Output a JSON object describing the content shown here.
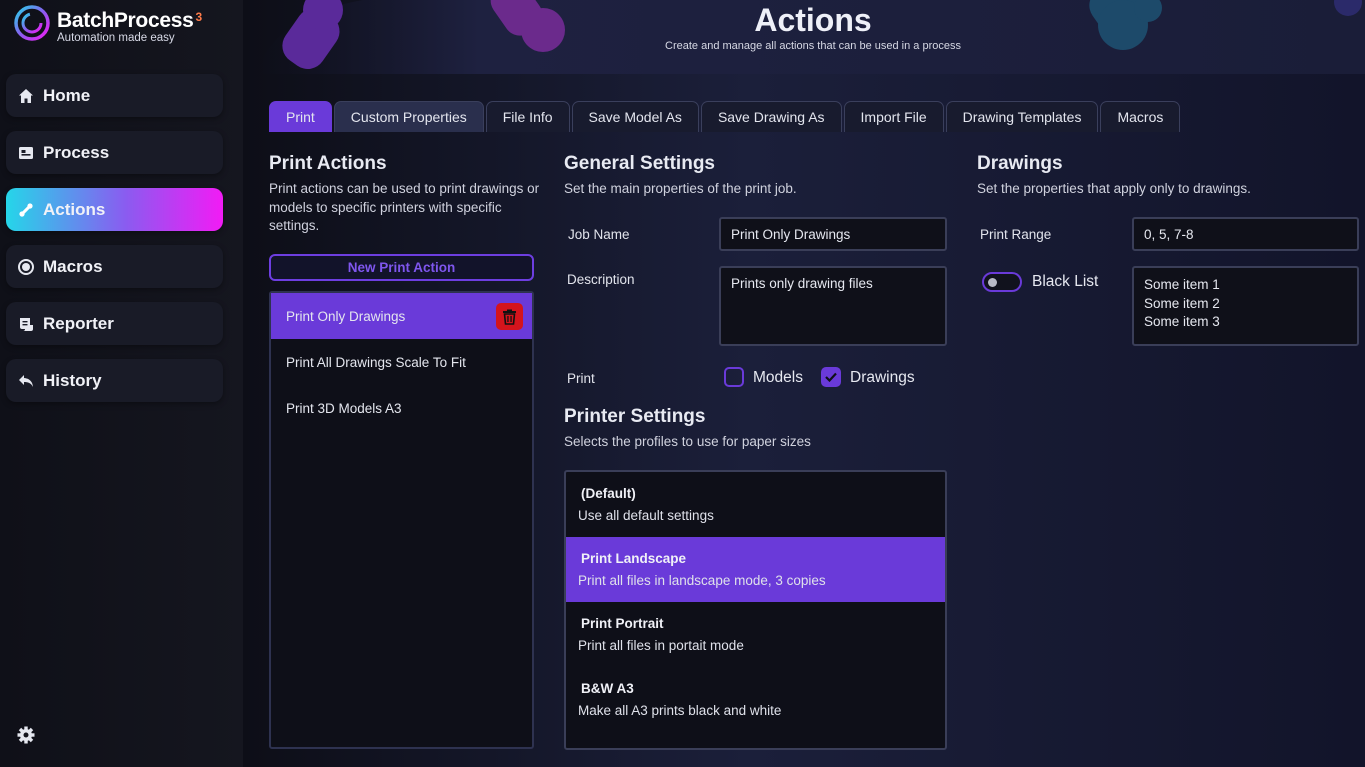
{
  "app": {
    "name": "BatchProcess",
    "version_mark": "3",
    "tagline": "Automation made easy"
  },
  "sidebar": {
    "items": [
      {
        "label": "Home",
        "icon": "home-icon"
      },
      {
        "label": "Process",
        "icon": "process-icon"
      },
      {
        "label": "Actions",
        "icon": "actions-icon",
        "active": true
      },
      {
        "label": "Macros",
        "icon": "macros-icon"
      },
      {
        "label": "Reporter",
        "icon": "reporter-icon"
      },
      {
        "label": "History",
        "icon": "history-icon"
      }
    ],
    "settings_icon": "gear-icon"
  },
  "header": {
    "title": "Actions",
    "subtitle": "Create and manage all actions that can be used in a process"
  },
  "tabs": [
    {
      "label": "Print",
      "active": true
    },
    {
      "label": "Custom Properties"
    },
    {
      "label": "File Info"
    },
    {
      "label": "Save Model As"
    },
    {
      "label": "Save Drawing As"
    },
    {
      "label": "Import File"
    },
    {
      "label": "Drawing Templates"
    },
    {
      "label": "Macros"
    }
  ],
  "print_actions": {
    "title": "Print Actions",
    "description": "Print actions can be used to print drawings or models to specific printers with specific settings.",
    "new_button": "New Print Action",
    "items": [
      {
        "label": "Print Only Drawings",
        "selected": true
      },
      {
        "label": "Print All Drawings Scale To Fit"
      },
      {
        "label": "Print 3D Models A3"
      }
    ]
  },
  "general_settings": {
    "title": "General Settings",
    "description": "Set the main properties of the print job.",
    "job_name_label": "Job Name",
    "job_name_value": "Print Only Drawings",
    "description_label": "Description",
    "description_value": "Prints only drawing files",
    "print_label": "Print",
    "models_label": "Models",
    "models_checked": false,
    "drawings_label": "Drawings",
    "drawings_checked": true
  },
  "printer_settings": {
    "title": "Printer Settings",
    "description": "Selects the profiles to use for paper sizes",
    "profiles": [
      {
        "name": "(Default)",
        "desc": "Use all default settings"
      },
      {
        "name": "Print Landscape",
        "desc": "Print all files in landscape mode, 3 copies",
        "selected": true
      },
      {
        "name": "Print Portrait",
        "desc": "Print all files in portait mode"
      },
      {
        "name": "B&W A3",
        "desc": "Make all A3 prints black and white"
      }
    ]
  },
  "drawings": {
    "title": "Drawings",
    "description": "Set the properties that apply only to drawings.",
    "print_range_label": "Print Range",
    "print_range_value": "0, 5, 7-8",
    "black_list_label": "Black List",
    "black_list_enabled": false,
    "black_list_items": [
      "Some item 1",
      "Some item 2",
      "Some item 3"
    ]
  },
  "colors": {
    "accent": "#6a3ad9",
    "active_gradient": [
      "#25d6e9",
      "#8a5cf0",
      "#f21bf5"
    ],
    "delete": "#d4141c"
  }
}
